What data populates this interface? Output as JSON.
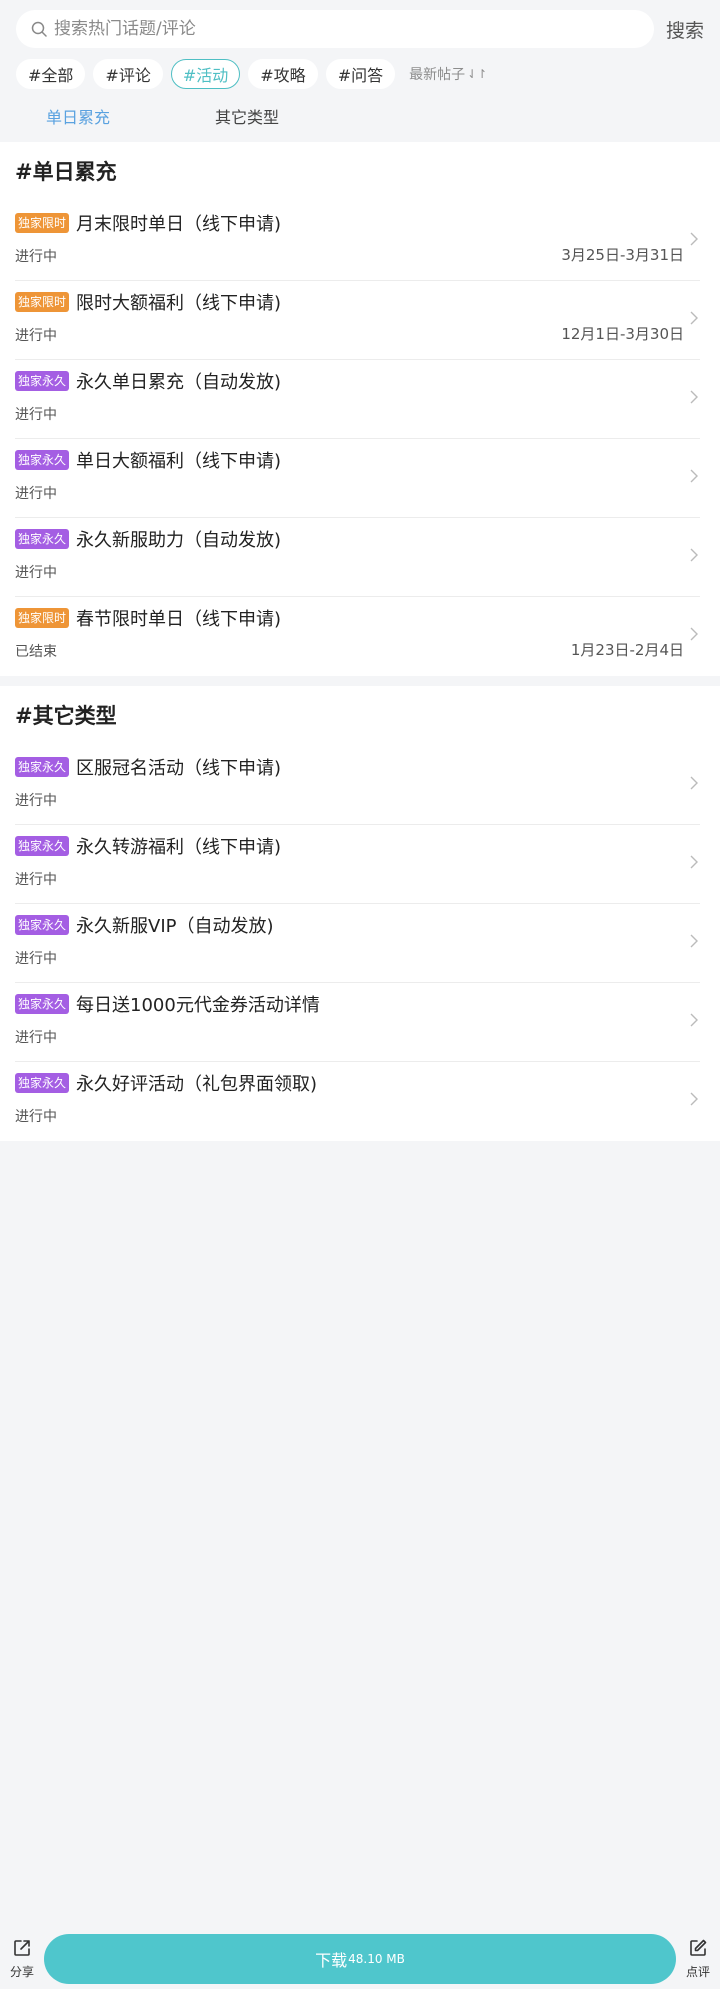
{
  "search": {
    "placeholder": "搜索热门话题/评论",
    "button_label": "搜索"
  },
  "tags": [
    "#全部",
    "#评论",
    "#活动",
    "#攻略",
    "#问答"
  ],
  "active_tag": "#活动",
  "sort_label": "最新帖子",
  "subtabs": [
    "单日累充",
    "其它类型"
  ],
  "sections": [
    {
      "title": "#单日累充",
      "items": [
        {
          "badge": "独家限时",
          "title": "月末限时单日（线下申请)",
          "status": "进行中",
          "date": "3月25日-3月31日"
        },
        {
          "badge": "独家限时",
          "title": "限时大额福利（线下申请)",
          "status": "进行中",
          "date": "12月1日-3月30日"
        },
        {
          "badge": "独家永久",
          "title": "永久单日累充（自动发放)",
          "status": "进行中",
          "date": ""
        },
        {
          "badge": "独家永久",
          "title": "单日大额福利（线下申请)",
          "status": "进行中",
          "date": ""
        },
        {
          "badge": "独家永久",
          "title": "永久新服助力（自动发放)",
          "status": "进行中",
          "date": ""
        },
        {
          "badge": "独家限时",
          "title": "春节限时单日（线下申请)",
          "status": "已结束",
          "date": "1月23日-2月4日"
        }
      ]
    },
    {
      "title": "#其它类型",
      "items": [
        {
          "badge": "独家永久",
          "title": "区服冠名活动（线下申请)",
          "status": "进行中",
          "date": ""
        },
        {
          "badge": "独家永久",
          "title": "永久转游福利（线下申请)",
          "status": "进行中",
          "date": ""
        },
        {
          "badge": "独家永久",
          "title": "永久新服VIP（自动发放)",
          "status": "进行中",
          "date": ""
        },
        {
          "badge": "独家永久",
          "title": "每日送1000元代金券活动详情",
          "status": "进行中",
          "date": ""
        },
        {
          "badge": "独家永久",
          "title": "永久好评活动（礼包界面领取)",
          "status": "进行中",
          "date": ""
        }
      ]
    }
  ],
  "bottom": {
    "share_label": "分享",
    "download_label": "下载",
    "download_size": "48.10 MB",
    "review_label": "点评"
  },
  "colors": {
    "accent": "#4fbfc4",
    "tab_active": "#5aa2e0",
    "badge_limited": "#ee9537",
    "badge_permanent": "#a45ee3",
    "background": "#f4f5f7"
  }
}
